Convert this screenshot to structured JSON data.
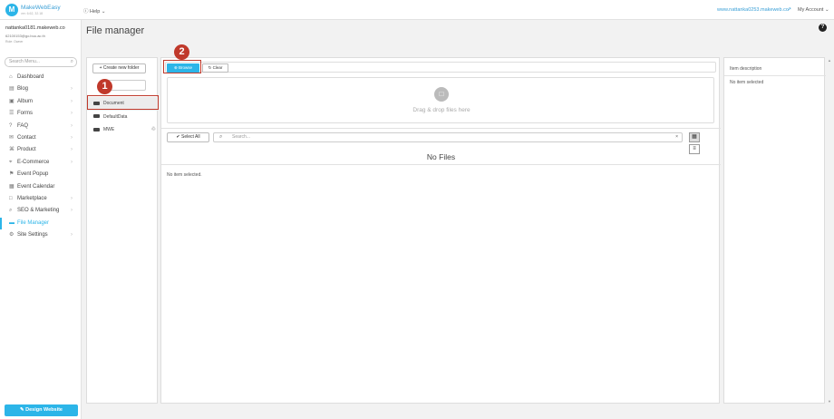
{
  "header": {
    "logo_letter": "M",
    "brand": "MakeWebEasy",
    "version": "ver. 6.62, 32.18",
    "help_label": "ⓘ Help ⌄",
    "site_url": "www.nattanka0253.makeweb.co",
    "my_account_label": "My Account ⌄"
  },
  "user": {
    "name": "nattanka0181.makeweb.co",
    "id": "62100153@go.buu.ac.th",
    "role": "Role: Owner"
  },
  "sidebar": {
    "search_placeholder": "Search Menu...",
    "items": [
      {
        "label": "Dashboard",
        "icon": "home-icon",
        "glyph": "⌂",
        "chevron": false
      },
      {
        "label": "Blog",
        "icon": "blog-icon",
        "glyph": "▤",
        "chevron": true
      },
      {
        "label": "Album",
        "icon": "album-icon",
        "glyph": "▣",
        "chevron": true
      },
      {
        "label": "Forms",
        "icon": "forms-icon",
        "glyph": "☰",
        "chevron": true
      },
      {
        "label": "FAQ",
        "icon": "faq-icon",
        "glyph": "?",
        "chevron": true
      },
      {
        "label": "Contact",
        "icon": "contact-icon",
        "glyph": "✉",
        "chevron": true
      },
      {
        "label": "Product",
        "icon": "product-icon",
        "glyph": "⌘",
        "chevron": true
      },
      {
        "label": "E-Commerce",
        "icon": "tag-icon",
        "glyph": "⌖",
        "chevron": true
      },
      {
        "label": "Event Popup",
        "icon": "popup-icon",
        "glyph": "⚑",
        "chevron": false
      },
      {
        "label": "Event Calendar",
        "icon": "calendar-icon",
        "glyph": "▦",
        "chevron": false
      },
      {
        "label": "Marketplace",
        "icon": "market-icon",
        "glyph": "□",
        "chevron": true
      },
      {
        "label": "SEO & Marketing",
        "icon": "seo-icon",
        "glyph": "⌕",
        "chevron": true
      },
      {
        "label": "File Manager",
        "icon": "folder-icon",
        "glyph": "▬",
        "chevron": false,
        "active": true
      },
      {
        "label": "Site Settings",
        "icon": "gear-icon",
        "glyph": "⚙",
        "chevron": true
      }
    ],
    "design_button": "✎ Design Website"
  },
  "page": {
    "title": "File manager",
    "help_glyph": "?"
  },
  "folders": {
    "create_button": "+ Create new folder",
    "items": [
      {
        "label": "Document",
        "selected": true
      },
      {
        "label": "DefaultData",
        "selected": false
      },
      {
        "label": "MWE",
        "selected": false
      }
    ]
  },
  "upload": {
    "browse_label": "⊕ Browse",
    "clear_label": "↻ Clear",
    "drop_text": "Drag & drop files here"
  },
  "toolbar": {
    "select_all_label": "✔ Select All",
    "search_placeholder": "Search...",
    "clear_search": "×"
  },
  "content": {
    "no_files": "No Files",
    "no_item_selected": "No item selected."
  },
  "description": {
    "title": "Item description",
    "empty": "No item selected"
  },
  "annotations": {
    "step1": "1",
    "step2": "2"
  },
  "colors": {
    "accent": "#2cb5e8",
    "annotation": "#c0392b"
  }
}
